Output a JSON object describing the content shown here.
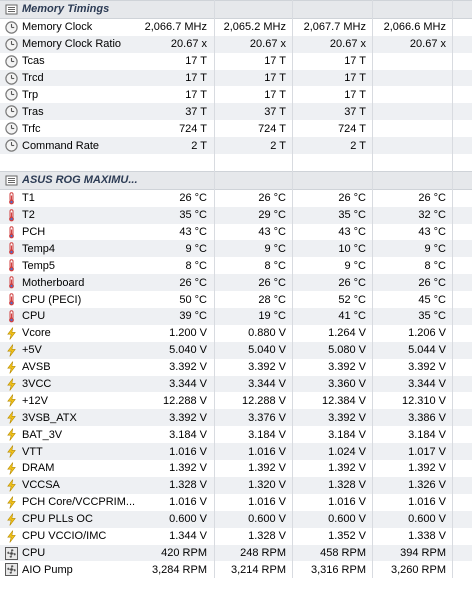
{
  "sections": [
    {
      "title": "Memory Timings",
      "rows": [
        {
          "icon": "clock",
          "label": "Memory Clock",
          "values": [
            "2,066.7 MHz",
            "2,065.2 MHz",
            "2,067.7 MHz",
            "2,066.6 MHz"
          ]
        },
        {
          "icon": "clock",
          "label": "Memory Clock Ratio",
          "values": [
            "20.67 x",
            "20.67 x",
            "20.67 x",
            "20.67 x"
          ]
        },
        {
          "icon": "clock",
          "label": "Tcas",
          "values": [
            "17 T",
            "17 T",
            "17 T",
            ""
          ]
        },
        {
          "icon": "clock",
          "label": "Trcd",
          "values": [
            "17 T",
            "17 T",
            "17 T",
            ""
          ]
        },
        {
          "icon": "clock",
          "label": "Trp",
          "values": [
            "17 T",
            "17 T",
            "17 T",
            ""
          ]
        },
        {
          "icon": "clock",
          "label": "Tras",
          "values": [
            "37 T",
            "37 T",
            "37 T",
            ""
          ]
        },
        {
          "icon": "clock",
          "label": "Trfc",
          "values": [
            "724 T",
            "724 T",
            "724 T",
            ""
          ]
        },
        {
          "icon": "clock",
          "label": "Command Rate",
          "values": [
            "2 T",
            "2 T",
            "2 T",
            ""
          ]
        }
      ]
    },
    {
      "title": "ASUS ROG MAXIMU...",
      "rows": [
        {
          "icon": "thermometer",
          "label": "T1",
          "values": [
            "26 °C",
            "26 °C",
            "26 °C",
            "26 °C"
          ]
        },
        {
          "icon": "thermometer",
          "label": "T2",
          "values": [
            "35 °C",
            "29 °C",
            "35 °C",
            "32 °C"
          ]
        },
        {
          "icon": "thermometer",
          "label": "PCH",
          "values": [
            "43 °C",
            "43 °C",
            "43 °C",
            "43 °C"
          ]
        },
        {
          "icon": "thermometer",
          "label": "Temp4",
          "values": [
            "9 °C",
            "9 °C",
            "10 °C",
            "9 °C"
          ]
        },
        {
          "icon": "thermometer",
          "label": "Temp5",
          "values": [
            "8 °C",
            "8 °C",
            "9 °C",
            "8 °C"
          ]
        },
        {
          "icon": "thermometer",
          "label": "Motherboard",
          "values": [
            "26 °C",
            "26 °C",
            "26 °C",
            "26 °C"
          ]
        },
        {
          "icon": "thermometer",
          "label": "CPU (PECI)",
          "values": [
            "50 °C",
            "28 °C",
            "52 °C",
            "45 °C"
          ]
        },
        {
          "icon": "thermometer",
          "label": "CPU",
          "values": [
            "39 °C",
            "19 °C",
            "41 °C",
            "35 °C"
          ]
        },
        {
          "icon": "lightning",
          "label": "Vcore",
          "values": [
            "1.200 V",
            "0.880 V",
            "1.264 V",
            "1.206 V"
          ]
        },
        {
          "icon": "lightning",
          "label": "+5V",
          "values": [
            "5.040 V",
            "5.040 V",
            "5.080 V",
            "5.044 V"
          ]
        },
        {
          "icon": "lightning",
          "label": "AVSB",
          "values": [
            "3.392 V",
            "3.392 V",
            "3.392 V",
            "3.392 V"
          ]
        },
        {
          "icon": "lightning",
          "label": "3VCC",
          "values": [
            "3.344 V",
            "3.344 V",
            "3.360 V",
            "3.344 V"
          ]
        },
        {
          "icon": "lightning",
          "label": "+12V",
          "values": [
            "12.288 V",
            "12.288 V",
            "12.384 V",
            "12.310 V"
          ]
        },
        {
          "icon": "lightning",
          "label": "3VSB_ATX",
          "values": [
            "3.392 V",
            "3.376 V",
            "3.392 V",
            "3.386 V"
          ]
        },
        {
          "icon": "lightning",
          "label": "BAT_3V",
          "values": [
            "3.184 V",
            "3.184 V",
            "3.184 V",
            "3.184 V"
          ]
        },
        {
          "icon": "lightning",
          "label": "VTT",
          "values": [
            "1.016 V",
            "1.016 V",
            "1.024 V",
            "1.017 V"
          ]
        },
        {
          "icon": "lightning",
          "label": "DRAM",
          "values": [
            "1.392 V",
            "1.392 V",
            "1.392 V",
            "1.392 V"
          ]
        },
        {
          "icon": "lightning",
          "label": "VCCSA",
          "values": [
            "1.328 V",
            "1.320 V",
            "1.328 V",
            "1.326 V"
          ]
        },
        {
          "icon": "lightning",
          "label": "PCH Core/VCCPRIM...",
          "values": [
            "1.016 V",
            "1.016 V",
            "1.016 V",
            "1.016 V"
          ]
        },
        {
          "icon": "lightning",
          "label": "CPU PLLs OC",
          "values": [
            "0.600 V",
            "0.600 V",
            "0.600 V",
            "0.600 V"
          ]
        },
        {
          "icon": "lightning",
          "label": "CPU VCCIO/IMC",
          "values": [
            "1.344 V",
            "1.328 V",
            "1.352 V",
            "1.338 V"
          ]
        },
        {
          "icon": "fan",
          "label": "CPU",
          "values": [
            "420 RPM",
            "248 RPM",
            "458 RPM",
            "394 RPM"
          ]
        },
        {
          "icon": "fan",
          "label": "AIO Pump",
          "values": [
            "3,284 RPM",
            "3,214 RPM",
            "3,316 RPM",
            "3,260 RPM"
          ]
        }
      ]
    }
  ],
  "colors": {
    "section_bg": "#e6e8eb",
    "alt_row": "#eef0f3",
    "clock_icon": "#7a7a7a",
    "thermometer_icon": "#4a6fd1",
    "lightning_icon": "#f2c21a",
    "fan_icon": "#5a5a5a"
  }
}
